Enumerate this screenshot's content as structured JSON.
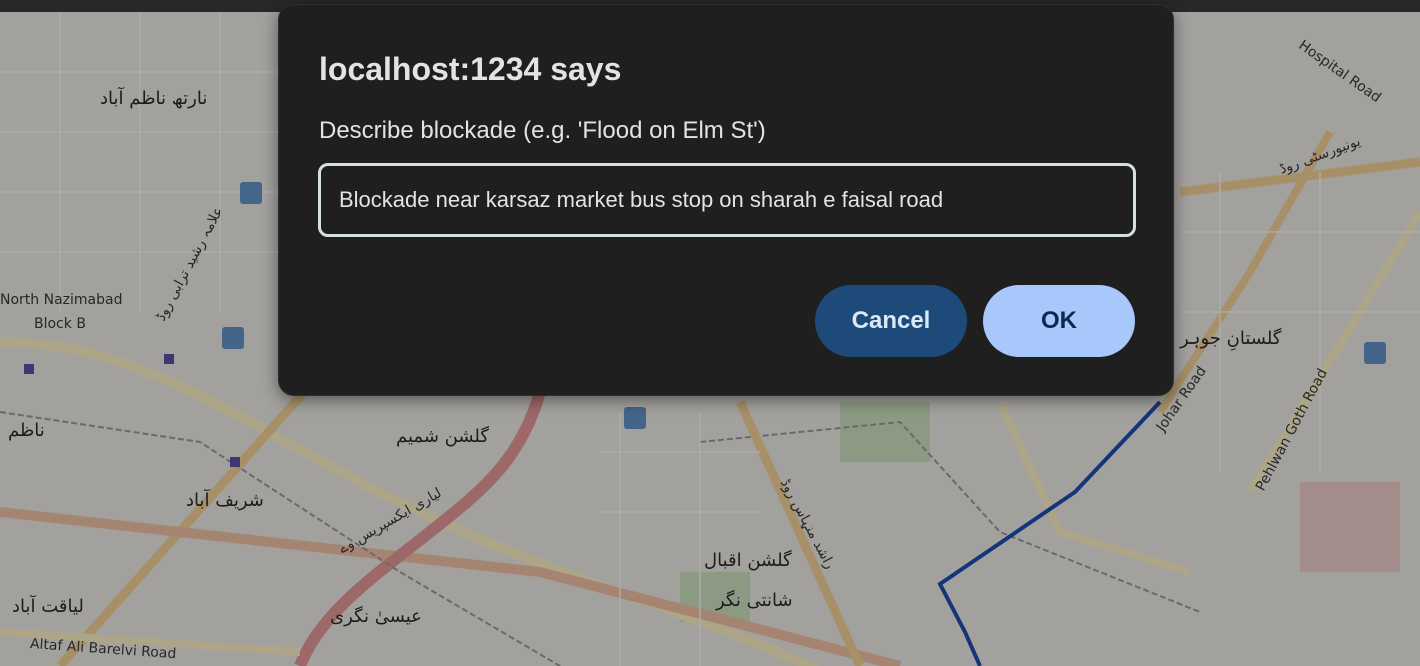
{
  "dialog": {
    "title": "localhost:1234 says",
    "message": "Describe blockade (e.g. 'Flood on Elm St')",
    "input_value": "Blockade near karsaz market bus stop on sharah e faisal road",
    "cancel_label": "Cancel",
    "ok_label": "OK",
    "accent_color": "#a8c7fa",
    "cancel_color": "#1e4a7a"
  },
  "map": {
    "labels": {
      "nazimabad_urdu": "نارتھ ناظم آباد",
      "north_nazimabad": "North Nazimabad",
      "block_b": "Block B",
      "nazim": "ناظم",
      "gulshan_shamim": "گلشن شمیم",
      "sharif_abad": "شریف آباد",
      "liaquatabad": "لیاقت آباد",
      "altaf": "Altaf Ali Barelvi Road",
      "essa_nagri": "عیسیٰ نگری",
      "gulshan_iqbal": "گلشن اقبال",
      "shanti_nagar": "شانتی نگر",
      "gulistan_johar": "گلستانِ جوہر",
      "university_road": "یونیورسٹی روڈ",
      "pehlwan_goth": "Pehlwan Goth Road",
      "hospital_road": "Hospital Road",
      "rashid_minhas": "راشد منہاس روڈ",
      "allama_rasheed": "علامہ رشید ترابی روڈ",
      "lyari_expressway": "لیاری ایکسپریس وے",
      "johar_road": "Johar Road"
    },
    "route_color": "#1f4fb4"
  }
}
